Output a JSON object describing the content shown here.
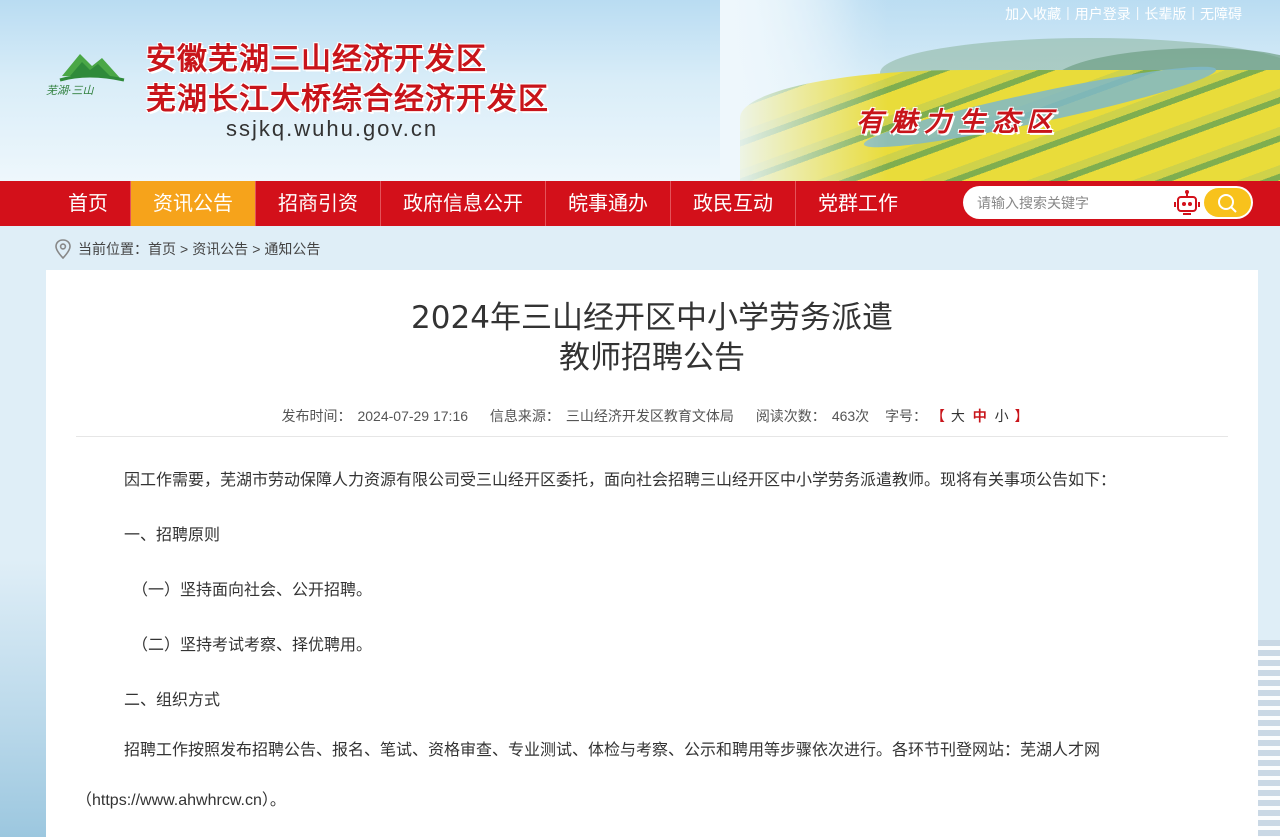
{
  "header": {
    "top_links": [
      "加入收藏",
      "用户登录",
      "长辈版",
      "无障碍"
    ],
    "logo_text": "芜湖·三山",
    "site_name_line1": "安徽芜湖三山经济开发区",
    "site_name_line2": "芜湖长江大桥综合经济开发区",
    "domain": "ssjkq.wuhu.gov.cn",
    "slogan": "有魅力生态区"
  },
  "nav": {
    "items": [
      {
        "label": "首页",
        "active": false
      },
      {
        "label": "资讯公告",
        "active": true
      },
      {
        "label": "招商引资",
        "active": false
      },
      {
        "label": "政府信息公开",
        "active": false
      },
      {
        "label": "皖事通办",
        "active": false
      },
      {
        "label": "政民互动",
        "active": false
      },
      {
        "label": "党群工作",
        "active": false
      }
    ],
    "active_color": "#f6a31b",
    "bar_color": "#d3101a"
  },
  "search": {
    "placeholder": "请输入搜索关键字",
    "robot_icon": "robot-icon",
    "button_icon": "search-icon"
  },
  "breadcrumb": {
    "prefix": "当前位置：",
    "items": [
      "首页",
      "资讯公告",
      "通知公告"
    ],
    "separator": ">"
  },
  "article": {
    "title_line1": "2024年三山经开区中小学劳务派遣",
    "title_line2": "教师招聘公告",
    "meta": {
      "published_label": "发布时间：",
      "published": "2024-07-29 17:16",
      "source_label": "信息来源：",
      "source": "三山经济开发区教育文体局",
      "views_label": "阅读次数：",
      "views": "463次",
      "font_label": "字号：",
      "bracket_open": "【",
      "bracket_close": "】",
      "size_large": "大",
      "size_medium": "中",
      "size_small": "小"
    },
    "paragraphs": {
      "intro": "因工作需要，芜湖市劳动保障人力资源有限公司受三山经开区委托，面向社会招聘三山经开区中小学劳务派遣教师。现将有关事项公告如下：",
      "section1": "一、招聘原则",
      "item1": "（一）坚持面向社会、公开招聘。",
      "item2": "（二）坚持考试考察、择优聘用。",
      "section2": "二、组织方式",
      "process": "招聘工作按照发布招聘公告、报名、笔试、资格审查、专业测试、体检与考察、公示和聘用等步骤依次进行。各环节刊登网站：芜湖人才网（https://www.ahwhrcw.cn）。"
    }
  }
}
